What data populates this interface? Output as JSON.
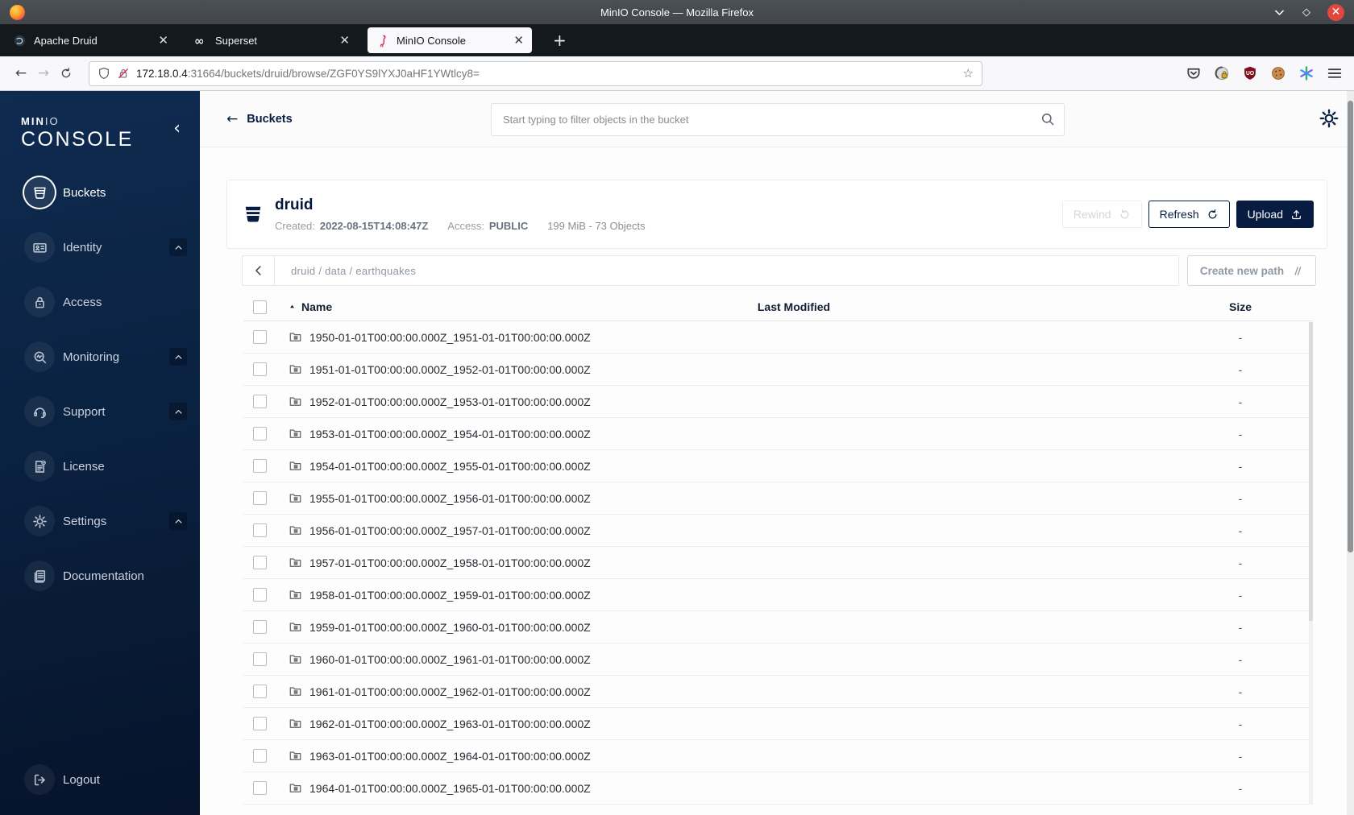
{
  "window": {
    "title": "MinIO Console — Mozilla Firefox",
    "controls": [
      "minimize-icon",
      "maximize-icon",
      "close-icon"
    ]
  },
  "browser": {
    "tabs": [
      {
        "label": "Apache Druid"
      },
      {
        "label": "Superset"
      },
      {
        "label": "MinIO Console"
      }
    ],
    "new_tab_label": "+",
    "url": {
      "host": "172.18.0.4",
      "rest": ":31664/buckets/druid/browse/ZGF0YS9lYXJ0aHF1YWtlcy8="
    },
    "toolbar_icons": [
      {
        "name": "pocket-icon",
        "icon": "pocket"
      },
      {
        "name": "extensions-icon",
        "icon": "extensions"
      },
      {
        "name": "adblock-shield-icon",
        "icon": "adblock"
      },
      {
        "name": "cookie-icon",
        "icon": "cookie"
      },
      {
        "name": "session-asterisk-icon",
        "icon": "asterisk"
      },
      {
        "name": "menu-icon",
        "icon": "menu"
      }
    ]
  },
  "sidebar": {
    "logo_prefix": "MIN",
    "logo_suffix": "IO",
    "logo_title": "CONSOLE",
    "items": [
      {
        "label": "Buckets",
        "icon": "bucket",
        "active": true,
        "expandable": false
      },
      {
        "label": "Identity",
        "icon": "idcard",
        "active": false,
        "expandable": true
      },
      {
        "label": "Access",
        "icon": "lock",
        "active": false,
        "expandable": false
      },
      {
        "label": "Monitoring",
        "icon": "monitor",
        "active": false,
        "expandable": true
      },
      {
        "label": "Support",
        "icon": "support",
        "active": false,
        "expandable": true
      },
      {
        "label": "License",
        "icon": "license",
        "active": false,
        "expandable": false
      },
      {
        "label": "Settings",
        "icon": "gear",
        "active": false,
        "expandable": true
      },
      {
        "label": "Documentation",
        "icon": "docs",
        "active": false,
        "expandable": false
      }
    ],
    "logout": {
      "label": "Logout",
      "icon": "logout"
    }
  },
  "header": {
    "back_label": "Buckets",
    "search_placeholder": "Start typing to filter objects in the bucket"
  },
  "bucket": {
    "name": "druid",
    "created_label": "Created:",
    "created": "2022-08-15T14:08:47Z",
    "access_label": "Access:",
    "access": "PUBLIC",
    "usage": "199 MiB - 73 Objects",
    "buttons": {
      "rewind": "Rewind",
      "refresh": "Refresh",
      "upload": "Upload"
    }
  },
  "browse": {
    "breadcrumb": "druid / data / earthquakes",
    "create_path_label": "Create new path",
    "columns": {
      "name": "Name",
      "last_modified": "Last Modified",
      "size": "Size"
    },
    "rows": [
      {
        "name": "1950-01-01T00:00:00.000Z_1951-01-01T00:00:00.000Z",
        "size": "-"
      },
      {
        "name": "1951-01-01T00:00:00.000Z_1952-01-01T00:00:00.000Z",
        "size": "-"
      },
      {
        "name": "1952-01-01T00:00:00.000Z_1953-01-01T00:00:00.000Z",
        "size": "-"
      },
      {
        "name": "1953-01-01T00:00:00.000Z_1954-01-01T00:00:00.000Z",
        "size": "-"
      },
      {
        "name": "1954-01-01T00:00:00.000Z_1955-01-01T00:00:00.000Z",
        "size": "-"
      },
      {
        "name": "1955-01-01T00:00:00.000Z_1956-01-01T00:00:00.000Z",
        "size": "-"
      },
      {
        "name": "1956-01-01T00:00:00.000Z_1957-01-01T00:00:00.000Z",
        "size": "-"
      },
      {
        "name": "1957-01-01T00:00:00.000Z_1958-01-01T00:00:00.000Z",
        "size": "-"
      },
      {
        "name": "1958-01-01T00:00:00.000Z_1959-01-01T00:00:00.000Z",
        "size": "-"
      },
      {
        "name": "1959-01-01T00:00:00.000Z_1960-01-01T00:00:00.000Z",
        "size": "-"
      },
      {
        "name": "1960-01-01T00:00:00.000Z_1961-01-01T00:00:00.000Z",
        "size": "-"
      },
      {
        "name": "1961-01-01T00:00:00.000Z_1962-01-01T00:00:00.000Z",
        "size": "-"
      },
      {
        "name": "1962-01-01T00:00:00.000Z_1963-01-01T00:00:00.000Z",
        "size": "-"
      },
      {
        "name": "1963-01-01T00:00:00.000Z_1964-01-01T00:00:00.000Z",
        "size": "-"
      },
      {
        "name": "1964-01-01T00:00:00.000Z_1965-01-01T00:00:00.000Z",
        "size": "-"
      }
    ]
  }
}
